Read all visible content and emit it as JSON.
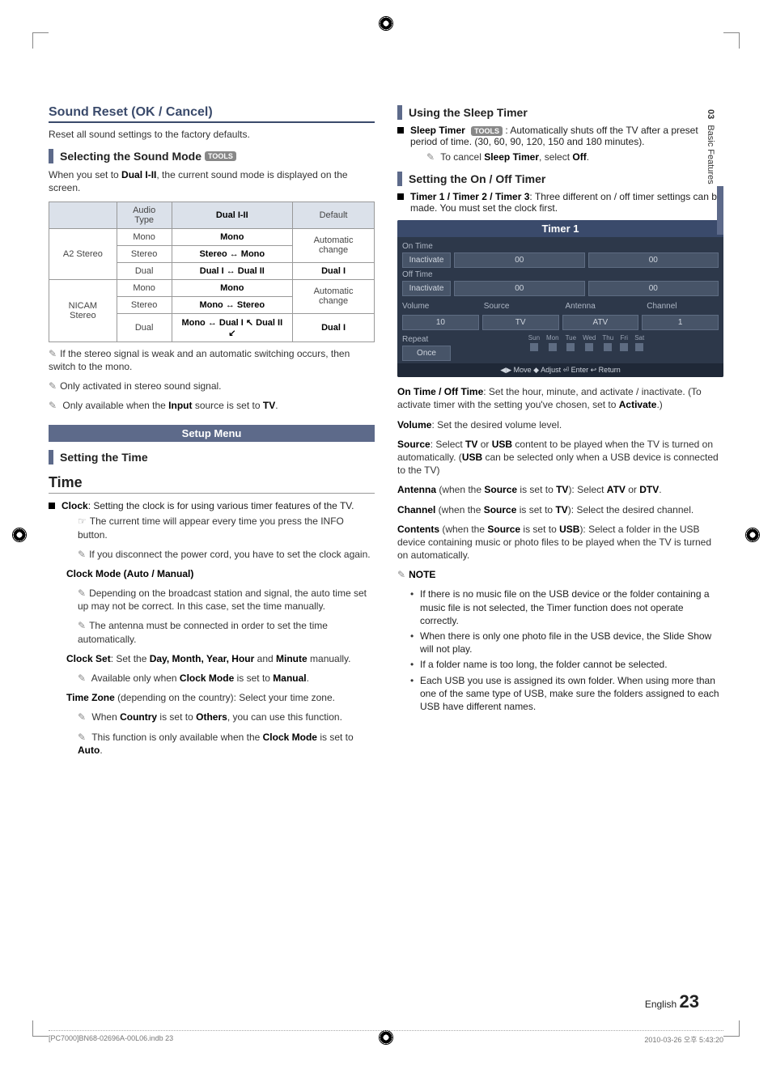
{
  "side": {
    "chapter_num": "03",
    "chapter_title": "Basic Features"
  },
  "left": {
    "h_sound_reset": "Sound Reset (OK / Cancel)",
    "p_sound_reset": "Reset all sound settings to the factory defaults.",
    "h_select_sound": "Selecting the Sound Mode",
    "tools_label": "TOOLS",
    "p_select_sound_1": "When you set to ",
    "p_select_sound_bold": "Dual I-II",
    "p_select_sound_2": ", the current sound mode is displayed on the screen.",
    "table": {
      "headers": [
        "",
        "Audio Type",
        "Dual I-II",
        "Default"
      ],
      "rows": [
        [
          "A2 Stereo",
          "Mono",
          "Mono",
          "Automatic change"
        ],
        [
          "",
          "Stereo",
          "Stereo ↔ Mono",
          ""
        ],
        [
          "",
          "Dual",
          "Dual I ↔ Dual II",
          "Dual I"
        ],
        [
          "NICAM Stereo",
          "Mono",
          "Mono",
          "Automatic change"
        ],
        [
          "",
          "Stereo",
          "Mono ↔ Stereo",
          ""
        ],
        [
          "",
          "Dual",
          "Mono ↔ Dual I ↖ Dual II ↙",
          "Dual I"
        ]
      ]
    },
    "note1": "If the stereo signal is weak and an automatic switching occurs, then switch to the mono.",
    "note2": "Only activated in stereo sound signal.",
    "note3_a": "Only available when the ",
    "note3_b": "Input",
    "note3_c": " source is set to ",
    "note3_d": "TV",
    "note3_e": ".",
    "setup_menu": "Setup Menu",
    "h_setting_time": "Setting the Time",
    "h_time": "Time",
    "clock_label": "Clock",
    "clock_desc": ": Setting the clock is for using various timer features of the TV.",
    "hand_note": "The current time will appear every time you press the INFO button.",
    "clock_note1": "If you disconnect the power cord, you have to set the clock again.",
    "clockmode_h": "Clock Mode (Auto / Manual)",
    "clockmode_n1": "Depending on the broadcast station and signal, the auto time set up may not be correct. In this case, set the time manually.",
    "clockmode_n2": "The antenna must be connected in order to set the time automatically.",
    "clockset_a": "Clock Set",
    "clockset_b": ": Set the ",
    "clockset_c": "Day, Month, Year, Hour",
    "clockset_d": " and ",
    "clockset_e": "Minute",
    "clockset_f": " manually.",
    "clockset_note_a": "Available only when ",
    "clockset_note_b": "Clock Mode",
    "clockset_note_c": " is set to ",
    "clockset_note_d": "Manual",
    "clockset_note_e": ".",
    "tz_a": "Time Zone",
    "tz_b": " (depending on the country): Select your time zone.",
    "tz_n1_a": "When ",
    "tz_n1_b": "Country",
    "tz_n1_c": " is set to ",
    "tz_n1_d": "Others",
    "tz_n1_e": ", you can use this function.",
    "tz_n2_a": "This function is only available when the ",
    "tz_n2_b": "Clock Mode",
    "tz_n2_c": " is set to ",
    "tz_n2_d": "Auto",
    "tz_n2_e": "."
  },
  "right": {
    "h_sleep": "Using the Sleep Timer",
    "sleep_a": "Sleep Timer",
    "sleep_b": ": Automatically shuts off the TV after a preset period of time. (30, 60, 90, 120, 150 and 180 minutes).",
    "sleep_note_a": "To cancel ",
    "sleep_note_b": "Sleep Timer",
    "sleep_note_c": ", select ",
    "sleep_note_d": "Off",
    "sleep_note_e": ".",
    "h_onoff": "Setting the On / Off Timer",
    "onoff_a": "Timer 1 / Timer 2 / Timer 3",
    "onoff_b": ": Three different on / off timer settings can be made. You must set the clock first.",
    "timer": {
      "title": "Timer 1",
      "ontime": "On Time",
      "offtime": "Off Time",
      "inactivate": "Inactivate",
      "zero": "00",
      "volume_l": "Volume",
      "source_l": "Source",
      "antenna_l": "Antenna",
      "channel_l": "Channel",
      "vol_v": "10",
      "src_v": "TV",
      "ant_v": "ATV",
      "ch_v": "1",
      "repeat_l": "Repeat",
      "repeat_v": "Once",
      "days": [
        "Sun",
        "Mon",
        "Tue",
        "Wed",
        "Thu",
        "Fri",
        "Sat"
      ],
      "footer": "◀▶ Move   ◆ Adjust   ⏎ Enter   ↩ Return"
    },
    "ot_a": "On Time / Off Time",
    "ot_b": ": Set the hour, minute, and activate / inactivate. (To activate timer with the setting you've chosen, set to ",
    "ot_c": "Activate",
    "ot_d": ".)",
    "vol_a": "Volume",
    "vol_b": ": Set the desired volume level.",
    "src_a": "Source",
    "src_b": ": Select ",
    "src_c": "TV",
    "src_d": " or ",
    "src_e": "USB",
    "src_f": " content to be played when the TV is turned on automatically. (",
    "src_g": "USB",
    "src_h": " can be selected only when a USB device is connected to the TV)",
    "ant_a": "Antenna",
    "ant_b": " (when the ",
    "ant_c": "Source",
    "ant_d": " is set to ",
    "ant_e": "TV",
    "ant_f": "): Select ",
    "ant_g": "ATV",
    "ant_h": " or ",
    "ant_i": "DTV",
    "ant_j": ".",
    "ch_a": "Channel",
    "ch_b": " (when the ",
    "ch_c": "Source",
    "ch_d": " is set to ",
    "ch_e": "TV",
    "ch_f": "): Select the desired channel.",
    "cn_a": "Contents",
    "cn_b": " (when the ",
    "cn_c": "Source",
    "cn_d": " is set to ",
    "cn_e": "USB",
    "cn_f": "): Select a folder in the USB device containing music or photo files to be played when the TV is turned on automatically.",
    "note_h": "NOTE",
    "bullets": [
      "If there is no music file on the USB device or the folder containing a music file is not selected, the Timer function does not operate correctly.",
      "When there is only one photo file in the USB device, the Slide Show will not play.",
      "If a folder name is too long, the folder cannot be selected.",
      "Each USB you use is assigned its own folder. When using more than one of the same type of USB, make sure the folders assigned to each USB have different names."
    ]
  },
  "footer": {
    "lang": "English",
    "page": "23",
    "file": "[PC7000]BN68-02696A-00L06.indb   23",
    "ts": "2010-03-26   오후 5:43:20"
  }
}
